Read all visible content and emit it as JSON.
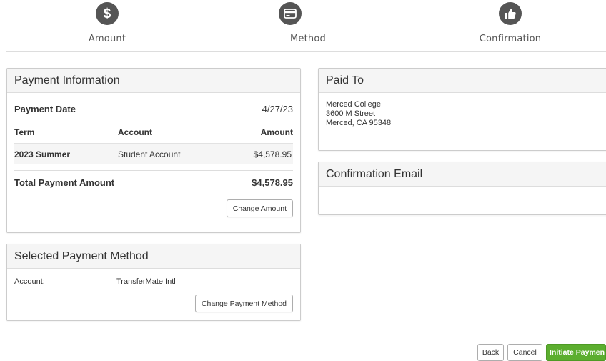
{
  "stepper": {
    "steps": [
      {
        "label": "Amount",
        "icon": "dollar-icon"
      },
      {
        "label": "Method",
        "icon": "credit-card-icon"
      },
      {
        "label": "Confirmation",
        "icon": "thumbs-up-icon"
      }
    ],
    "active_step": "Confirmation"
  },
  "payment_info": {
    "title": "Payment Information",
    "date_label": "Payment Date",
    "date_value": "4/27/23",
    "columns": {
      "term": "Term",
      "account": "Account",
      "amount": "Amount"
    },
    "rows": [
      {
        "term": "2023 Summer",
        "account": "Student Account",
        "amount": "$4,578.95"
      }
    ],
    "total_label": "Total Payment Amount",
    "total_value": "$4,578.95",
    "change_amount_label": "Change Amount"
  },
  "selected_method": {
    "title": "Selected Payment Method",
    "account_label": "Account:",
    "account_value": "TransferMate Intl",
    "change_method_label": "Change Payment Method"
  },
  "paid_to": {
    "title": "Paid To",
    "lines": [
      "Merced College",
      "3600 M Street",
      "Merced, CA 95348"
    ]
  },
  "confirmation_email": {
    "title": "Confirmation Email"
  },
  "footer": {
    "back_label": "Back",
    "cancel_label": "Cancel",
    "initiate_label": "Initiate Payment"
  },
  "colors": {
    "step_circle": "#555555",
    "primary_button": "#5cae2f",
    "panel_header_bg": "#f5f5f5",
    "border": "#cccccc"
  }
}
